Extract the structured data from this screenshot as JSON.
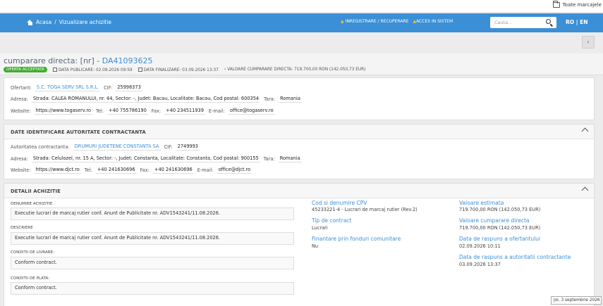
{
  "bookmarks": {
    "all_label": "Toate marcajele"
  },
  "nav": {
    "breadcrumb_home": "Acasa",
    "breadcrumb_sep": "/",
    "breadcrumb_current": "Vizualizare achizitie",
    "register_label": "INREGISTRARE / RECUPERARE",
    "access_label": "ACCES IN SISTEM",
    "search_placeholder": "Cauta...",
    "lang_ro": "RO",
    "lang_sep": "|",
    "lang_en": "EN"
  },
  "header": {
    "title_prefix": "cumparare directa: [nr] - ",
    "code": "DA41093625",
    "status_badge": "OFERTA ACCEPTATA",
    "publish_label": "DATA PUBLICARE:",
    "publish_value": "02.09.2026 09:59",
    "final_label": "DATA FINALIZARE:",
    "final_value": "03.09.2026 13:37",
    "value_label": "VALOARE CUMPARARE DIRECTA:",
    "value_value": "719.700,00",
    "value_currency": "RON (142.050,73 EUR)"
  },
  "offer": {
    "bidder_label": "Ofertant:",
    "bidder_value": "S.C. TOGA SERV SRL S.R.L.",
    "cif_label": "CIF:",
    "cif_value": "25998373",
    "address_label": "Adresa:",
    "address_value": "Strada: CALEA ROMANULUI, nr. 44, Sector: -, Judet: Bacau, Localitate: Bacau, Cod postal: 600354",
    "country_label": "Tara:",
    "country_value": "Romania",
    "website_label": "Website:",
    "website_value": "https://www.togaserv.ro",
    "tel_label": "Tel:",
    "tel_value": "+40 755786190",
    "fax_label": "Fax:",
    "fax_value": "+40 234511939",
    "email_label": "E-mail:",
    "email_value": "office@togaserv.ro"
  },
  "authority": {
    "section_title": "DATE IDENTIFICARE AUTORITATE CONTRACTANTA",
    "authority_label": "Autoritatea contractanta:",
    "authority_value": "DRUMURI JUDETENE CONSTANTA SA",
    "cif_label": "CIF:",
    "cif_value": "2749993",
    "address_label": "Adresa:",
    "address_value": "Strada: Celulozei, nr. 15 A, Sector: -, Judet: Constanta, Localitate: Constanta, Cod postal: 900155",
    "country_label": "Tara:",
    "country_value": "Romania",
    "website_label": "Website:",
    "website_value": "https://www.djct.ro",
    "tel_label": "Tel:",
    "tel_value": "+40 241630696",
    "fax_label": "Fax:",
    "fax_value": "+40 241630696",
    "email_label": "E-mail:",
    "email_value": "office@djct.ro"
  },
  "details": {
    "section_title": "DETALII ACHIZITIE",
    "name_label": "DENUMIRE ACHIZITIE",
    "name_value": "Executie lucrari de marcaj rutier conf. Anunt de Publicitate nr. ADV1543241/11.08.2026.",
    "desc_label": "DESCRIERE",
    "desc_value": "Executie lucrari de marcaj rutier conf. Anunt de Publicitate nr. ADV1543241/11.08.2026.",
    "delivery_label": "CONDITII DE LIVRARE:",
    "delivery_value": "Conform contract.",
    "payment_label": "CONDITII DE PLATA:",
    "payment_value": "Conform contract.",
    "cpv_title": "Cod si denumire CPV",
    "cpv_value": "45233221-4 - Lucrari de marcaj rutier (Rev.2)",
    "contract_type_title": "Tip de contract",
    "contract_type_value": "Lucrari",
    "eu_funds_title": "Finantare prin fonduri comunitare",
    "eu_funds_value": "Nu",
    "est_value_title": "Valoare estimata",
    "est_value_value": "719.700,00  RON (142.050,73  EUR)",
    "direct_value_title": "Valoare cumparare directa",
    "direct_value_value": "719.700,00  RON (142.050,73  EUR)",
    "bidder_reply_title": "Data de raspuns a ofertantului",
    "bidder_reply_value": "02.09.2026 10:11",
    "authority_reply_title": "Data de raspuns a autoritatii contractante",
    "authority_reply_value": "03.09.2026 13:37"
  },
  "status_tip": "joi, 3 septembrie 2026"
}
